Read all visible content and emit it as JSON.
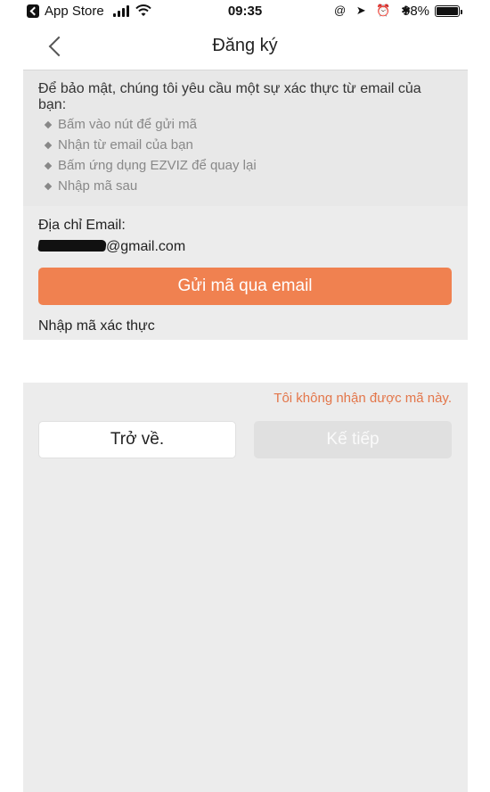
{
  "status_bar": {
    "back_app": "App Store",
    "time": "09:35",
    "right_icons": "@ ➤ ⏰ ✱",
    "battery_percent": "98%",
    "battery_level": 0.98
  },
  "nav": {
    "title": "Đăng ký"
  },
  "intro": {
    "text": "Để bảo mật, chúng tôi yêu cầu một sự xác thực từ email của bạn:",
    "steps": [
      "Bấm vào nút để gửi mã",
      "Nhận từ email của bạn",
      "Bấm ứng dụng EZVIZ để quay lại",
      "Nhập mã sau"
    ]
  },
  "email": {
    "label": "Địa chỉ Email:",
    "domain": "@gmail.com"
  },
  "buttons": {
    "send_code": "Gửi mã qua email",
    "back": "Trở về.",
    "next": "Kế tiếp"
  },
  "code": {
    "label": "Nhập mã xác thực",
    "value": "",
    "placeholder": ""
  },
  "links": {
    "not_received": "Tôi không nhận được mã này."
  },
  "colors": {
    "accent": "#f08150",
    "link": "#e3764a",
    "panel_bg": "#ececec",
    "disabled_button": "#e0e0e0"
  }
}
